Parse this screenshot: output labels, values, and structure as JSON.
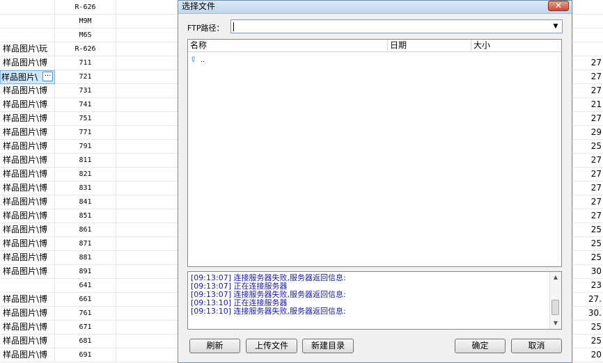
{
  "background_table": {
    "rows": [
      {
        "path": "",
        "code": "R-626",
        "right": ""
      },
      {
        "path": "",
        "code": "M9M",
        "right": ""
      },
      {
        "path": "",
        "code": "M6S",
        "right": ""
      },
      {
        "path": "样品图片\\玩",
        "code": "R-626",
        "right": ""
      },
      {
        "path": "样品图片\\博",
        "code": "711",
        "right": "27"
      },
      {
        "path": "样品图片\\",
        "code": "721",
        "right": "27",
        "selected": true
      },
      {
        "path": "样品图片\\博",
        "code": "731",
        "right": "27"
      },
      {
        "path": "样品图片\\博",
        "code": "741",
        "right": "21"
      },
      {
        "path": "样品图片\\博",
        "code": "751",
        "right": "27"
      },
      {
        "path": "样品图片\\博",
        "code": "771",
        "right": "29"
      },
      {
        "path": "样品图片\\博",
        "code": "791",
        "right": "25"
      },
      {
        "path": "样品图片\\博",
        "code": "811",
        "right": "27"
      },
      {
        "path": "样品图片\\博",
        "code": "821",
        "right": "27"
      },
      {
        "path": "样品图片\\博",
        "code": "831",
        "right": "27"
      },
      {
        "path": "样品图片\\博",
        "code": "841",
        "right": "27"
      },
      {
        "path": "样品图片\\博",
        "code": "851",
        "right": "27"
      },
      {
        "path": "样品图片\\博",
        "code": "861",
        "right": "25"
      },
      {
        "path": "样品图片\\博",
        "code": "871",
        "right": "25"
      },
      {
        "path": "样品图片\\博",
        "code": "881",
        "right": "25"
      },
      {
        "path": "样品图片\\博",
        "code": "891",
        "right": "30"
      },
      {
        "path": "",
        "code": "641",
        "right": "23"
      },
      {
        "path": "样品图片\\博",
        "code": "661",
        "right": "27."
      },
      {
        "path": "样品图片\\博",
        "code": "761",
        "right": "30."
      },
      {
        "path": "样品图片\\博",
        "code": "671",
        "right": "25"
      },
      {
        "path": "样品图片\\博",
        "code": "681",
        "right": "25"
      },
      {
        "path": "样品图片\\博",
        "code": "691",
        "right": "20"
      }
    ],
    "ellipsis_label": "···"
  },
  "dialog": {
    "title": "选择文件",
    "close_label": "✕",
    "ftp_label": "FTP路径：",
    "ftp_value": "",
    "dropdown_glyph": "▼",
    "columns": [
      "名称",
      "日期",
      "大小"
    ],
    "up_icon": "up-arrow-icon",
    "up_glyph": "⇧",
    "up_label": "..",
    "log_lines": [
      "[09:13:07] 连接服务器失败,服务器返回信息:",
      "[09:13:07] 正在连接服务器",
      "[09:13:07] 连接服务器失败,服务器返回信息:",
      "[09:13:10] 正在连接服务器",
      "[09:13:10] 连接服务器失败,服务器返回信息:"
    ],
    "scroll_up_glyph": "▲",
    "scroll_down_glyph": "▼",
    "buttons": {
      "refresh": "刷新",
      "upload": "上传文件",
      "new_dir": "新建目录",
      "ok": "确定",
      "cancel": "取消"
    }
  }
}
